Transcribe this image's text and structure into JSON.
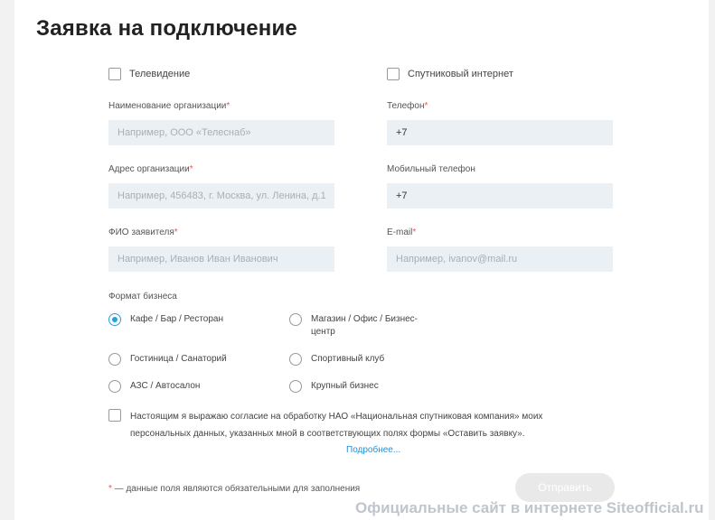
{
  "form": {
    "title": "Заявка на подключение",
    "checkbox_tv": "Телевидение",
    "checkbox_sat": "Спутниковый интернет",
    "org_name": {
      "label": "Наименование организации",
      "placeholder": "Например, ООО «Телеснаб»"
    },
    "phone": {
      "label": "Телефон",
      "value": "+7"
    },
    "org_address": {
      "label": "Адрес организации",
      "placeholder": "Например, 456483, г. Москва, ул. Ленина, д.1"
    },
    "mobile": {
      "label": "Мобильный телефон",
      "value": "+7"
    },
    "fio": {
      "label": "ФИО заявителя",
      "placeholder": "Например, Иванов Иван Иванович"
    },
    "email": {
      "label": "E-mail",
      "placeholder": "Например, ivanov@mail.ru"
    },
    "required_mark": "*",
    "business_label": "Формат бизнеса",
    "business_options": [
      "Кафе / Бар / Ресторан",
      "Магазин / Офис / Бизнес-центр",
      "Гостиница / Санаторий",
      "Спортивный клуб",
      "АЗС / Автосалон",
      "Крупный бизнес"
    ],
    "business_selected": "Кафе / Бар / Ресторан",
    "consent_text": "Настоящим я выражаю согласие на обработку НАО «Национальная спутниковая компания» моих персональных данных, указанных мной в соответствующих полях формы «Оставить заявку».",
    "more_link": "Подробнее...",
    "required_note": " — данные поля являются обязательными для заполнения",
    "submit": "Отправить"
  },
  "watermark": "Официальные сайт в интернете Siteofficial.ru",
  "colors": {
    "accent": "#2aa0d6",
    "input_bg": "#eaf0f3",
    "required": "#e25a5a",
    "link": "#2a8fd0"
  }
}
